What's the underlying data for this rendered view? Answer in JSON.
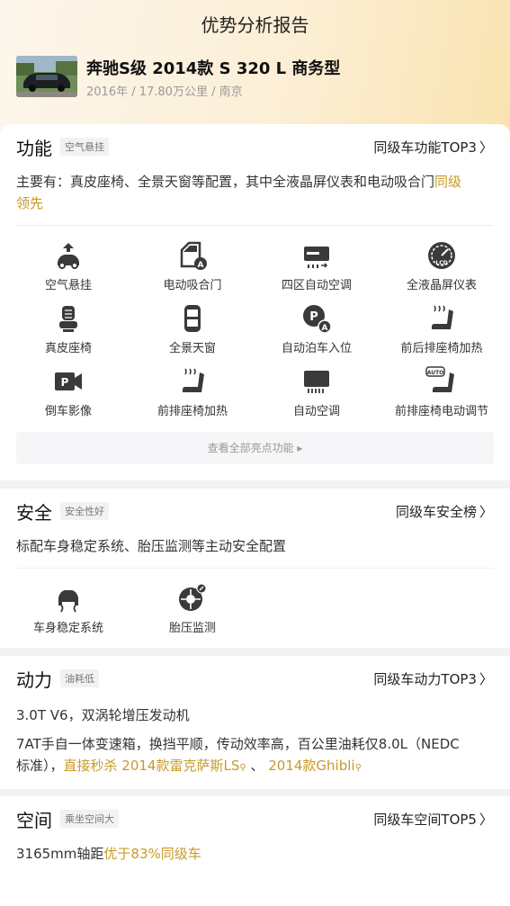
{
  "page": {
    "title": "优势分析报告"
  },
  "car": {
    "name": "奔驰S级 2014款 S 320 L 商务型",
    "meta": "2016年 / 17.80万公里 / 南京"
  },
  "function": {
    "title": "功能",
    "tag": "空气悬挂",
    "link": "同级车功能TOP3",
    "desc_line1_plain": "主要有：真皮座椅、全景天窗等配置，其中全液晶屏仪表和电动吸合门",
    "desc_line1_gold": "同级",
    "desc_line2_gold": "领先",
    "features": [
      {
        "label": "空气悬挂",
        "icon": "air-suspension-icon"
      },
      {
        "label": "电动吸合门",
        "icon": "soft-close-door-icon"
      },
      {
        "label": "四区自动空调",
        "icon": "four-zone-ac-icon"
      },
      {
        "label": "全液晶屏仪表",
        "icon": "lcd-dashboard-icon"
      },
      {
        "label": "真皮座椅",
        "icon": "leather-seat-icon"
      },
      {
        "label": "全景天窗",
        "icon": "panoramic-sunroof-icon"
      },
      {
        "label": "自动泊车入位",
        "icon": "auto-parking-icon"
      },
      {
        "label": "前后排座椅加热",
        "icon": "front-rear-seat-heating-icon"
      },
      {
        "label": "倒车影像",
        "icon": "reverse-camera-icon"
      },
      {
        "label": "前排座椅加热",
        "icon": "front-seat-heating-icon"
      },
      {
        "label": "自动空调",
        "icon": "auto-ac-icon"
      },
      {
        "label": "前排座椅电动调节",
        "icon": "power-seat-adjust-icon"
      }
    ],
    "more": "查看全部亮点功能 ▸"
  },
  "safety": {
    "title": "安全",
    "tag": "安全性好",
    "link": "同级车安全榜",
    "desc": "标配车身稳定系统、胎压监测等主动安全配置",
    "features": [
      {
        "label": "车身稳定系统",
        "icon": "stability-control-icon"
      },
      {
        "label": "胎压监测",
        "icon": "tire-pressure-icon"
      }
    ]
  },
  "power": {
    "title": "动力",
    "tag": "油耗低",
    "link": "同级车动力TOP3",
    "engine": "3.0T V6，双涡轮增压发动机",
    "trans_line1": "7AT手自一体变速箱，换挡平顺，传动效率高，百公里油耗仅8.0L（NEDC",
    "trans_line2_plain": "标准），",
    "trans_line2_gold": "直接秒杀 2014款雷克萨斯LS",
    "sep": "、",
    "compare2": "2014款Ghibli"
  },
  "space": {
    "title": "空间",
    "tag": "乘坐空间大",
    "link": "同级车空间TOP5",
    "desc_plain": "3165mm轴距",
    "desc_gold": "优于83%同级车"
  },
  "colors": {
    "gold": "#c79a29",
    "icon": "#3a3a3a"
  }
}
